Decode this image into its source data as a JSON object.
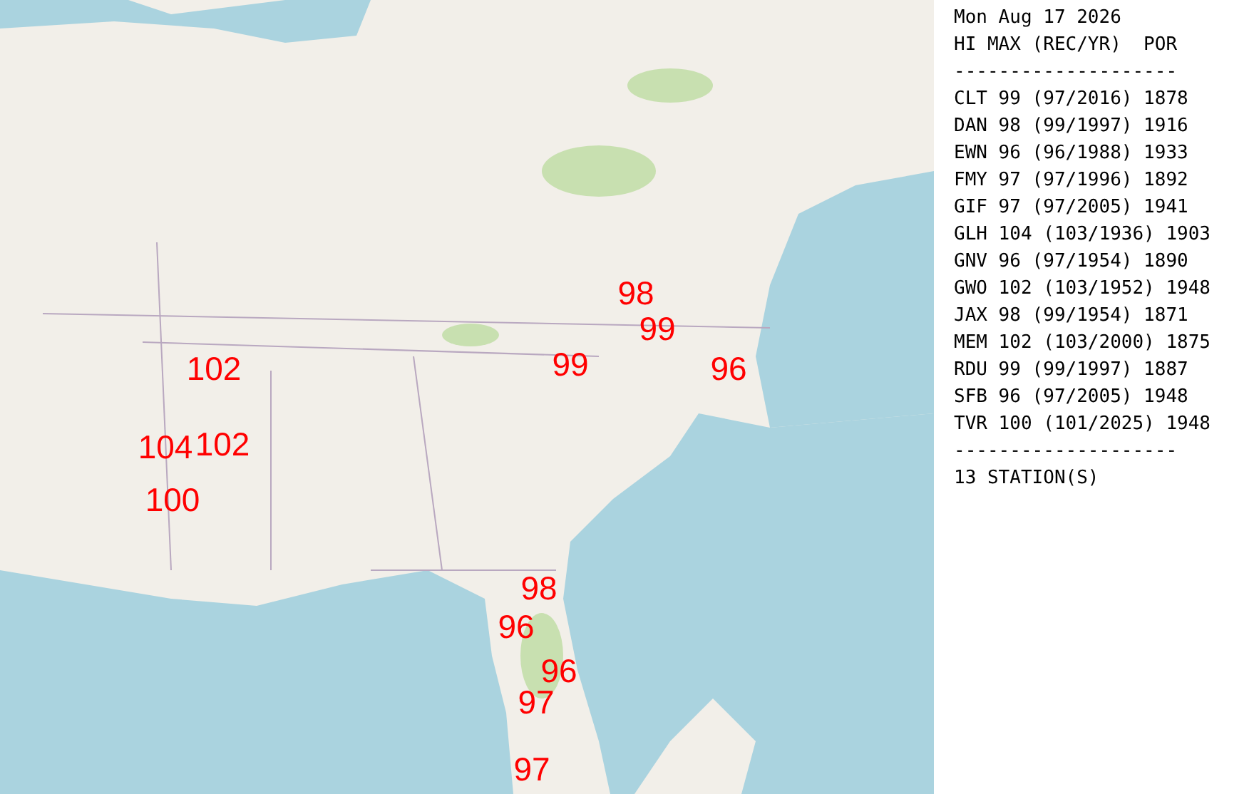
{
  "map": {
    "markers": [
      "98",
      "99",
      "102",
      "99",
      "96",
      "104",
      "102",
      "100",
      "98",
      "96",
      "96",
      "97",
      "97"
    ]
  },
  "report": {
    "date": "Mon Aug 17 2026",
    "header": "HI MAX (REC/YR)  POR",
    "separator_top": "--------------------",
    "rows": [
      "CLT 99 (97/2016) 1878",
      "DAN 98 (99/1997) 1916",
      "EWN 96 (96/1988) 1933",
      "FMY 97 (97/1996) 1892",
      "GIF 97 (97/2005) 1941",
      "GLH 104 (103/1936) 1903",
      "GNV 96 (97/1954) 1890",
      "GWO 102 (103/1952) 1948",
      "JAX 98 (99/1954) 1871",
      "MEM 102 (103/2000) 1875",
      "RDU 99 (99/1997) 1887",
      "SFB 96 (97/2005) 1948",
      "TVR 100 (101/2025) 1948"
    ],
    "separator_bottom": "--------------------",
    "footer": "13 STATION(S)"
  }
}
